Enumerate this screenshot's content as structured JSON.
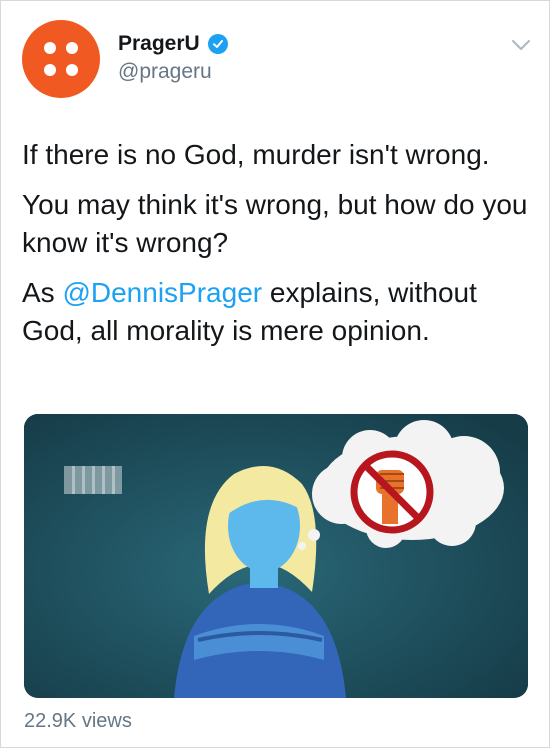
{
  "account": {
    "display_name": "PragerU",
    "handle": "@prageru",
    "verified": true,
    "avatar_color": "#f05a22"
  },
  "tweet": {
    "line1": "If there is no God, murder isn't wrong.",
    "line2": "You may think it's wrong, but how do you know it's wrong?",
    "line3_prefix": "As ",
    "line3_mention": "@DennisPrager",
    "line3_suffix": " explains, without God, all morality is mere opinion."
  },
  "media": {
    "type": "video",
    "background_color": "#1f4f5e",
    "icons": [
      "woman-figure-icon",
      "thought-bubble-icon",
      "no-fist-icon"
    ]
  },
  "stats": {
    "views": "22.9K views"
  },
  "colors": {
    "accent": "#1da1f2",
    "secondary_text": "#657786"
  }
}
